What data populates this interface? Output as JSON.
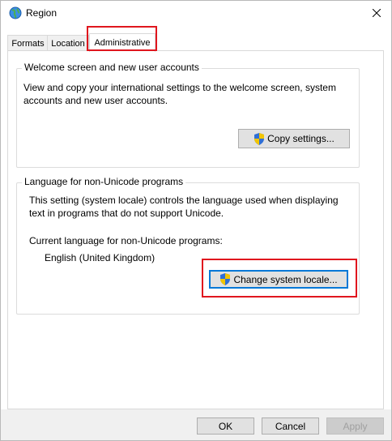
{
  "window": {
    "title": "Region",
    "title_icon": "globe-icon",
    "close_icon": "close-icon"
  },
  "tabs": [
    {
      "label": "Formats",
      "active": false
    },
    {
      "label": "Location",
      "active": false
    },
    {
      "label": "Administrative",
      "active": true
    }
  ],
  "welcome_group": {
    "title": "Welcome screen and new user accounts",
    "description": "View and copy your international settings to the welcome screen, system accounts and new user accounts.",
    "button_label": "Copy settings...",
    "button_icon": "uac-shield-icon"
  },
  "unicode_group": {
    "title": "Language for non-Unicode programs",
    "description": "This setting (system locale) controls the language used when displaying text in programs that do not support Unicode.",
    "current_label": "Current language for non-Unicode programs:",
    "current_value": "English (United Kingdom)",
    "button_label": "Change system locale...",
    "button_icon": "uac-shield-icon"
  },
  "footer": {
    "ok_label": "OK",
    "cancel_label": "Cancel",
    "apply_label": "Apply"
  },
  "colors": {
    "highlight": "#e0161e",
    "focus": "#0078d7"
  }
}
